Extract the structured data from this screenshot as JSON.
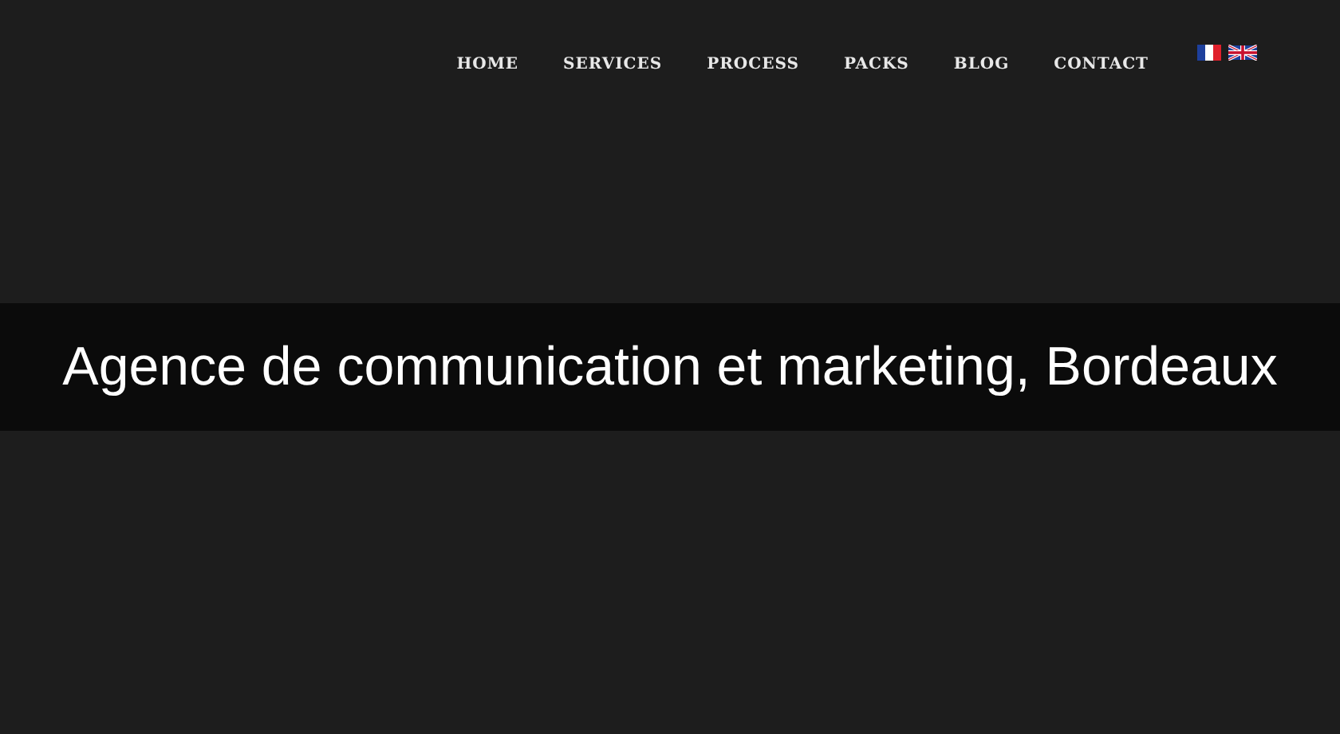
{
  "nav": [
    {
      "label": "HOME"
    },
    {
      "label": "SERVICES"
    },
    {
      "label": "PROCESS"
    },
    {
      "label": "PACKS"
    },
    {
      "label": "BLOG"
    },
    {
      "label": "CONTACT"
    }
  ],
  "banner": {
    "title": "Agence de communication et marketing, Bordeaux"
  }
}
